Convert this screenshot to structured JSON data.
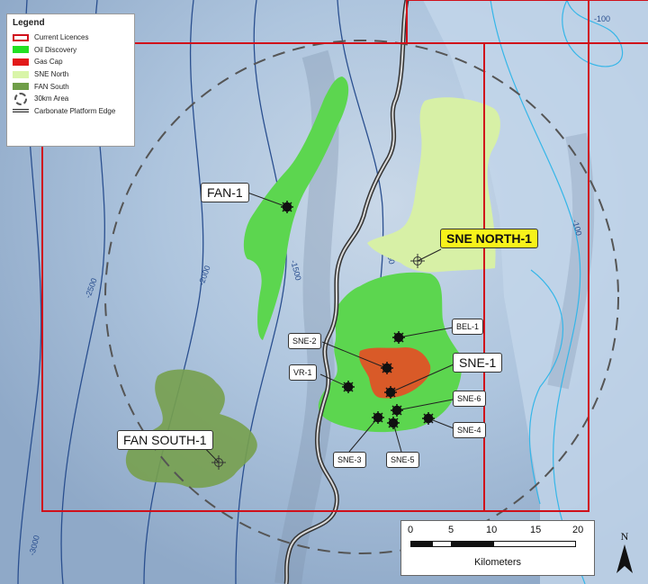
{
  "legend": {
    "title": "Legend",
    "items": [
      {
        "label": "Current Licences",
        "swatch": "licence-outline",
        "color": "#d0101a"
      },
      {
        "label": "Oil Discovery",
        "swatch": "fill",
        "color": "#22e022"
      },
      {
        "label": "Gas Cap",
        "swatch": "fill",
        "color": "#e21a1a"
      },
      {
        "label": "SNE North",
        "swatch": "fill",
        "color": "#d9f5a9"
      },
      {
        "label": "FAN South",
        "swatch": "fill",
        "color": "#6f9e48"
      },
      {
        "label": "30km Area",
        "swatch": "dashed-circle",
        "color": "#555555"
      },
      {
        "label": "Carbonate Platform Edge",
        "swatch": "double-line",
        "color": "#333333"
      }
    ]
  },
  "contours": [
    "-100",
    "-100",
    "-1000",
    "-1500",
    "-2000",
    "-2500",
    "-3000"
  ],
  "wells": [
    {
      "label": "FAN-1",
      "size": "big",
      "highlight": false
    },
    {
      "label": "SNE NORTH-1",
      "size": "big",
      "highlight": true
    },
    {
      "label": "SNE-1",
      "size": "big",
      "highlight": false
    },
    {
      "label": "FAN SOUTH-1",
      "size": "big",
      "highlight": false
    },
    {
      "label": "BEL-1",
      "size": "small",
      "highlight": false
    },
    {
      "label": "SNE-2",
      "size": "small",
      "highlight": false
    },
    {
      "label": "VR-1",
      "size": "small",
      "highlight": false
    },
    {
      "label": "SNE-6",
      "size": "small",
      "highlight": false
    },
    {
      "label": "SNE-4",
      "size": "small",
      "highlight": false
    },
    {
      "label": "SNE-3",
      "size": "small",
      "highlight": false
    },
    {
      "label": "SNE-5",
      "size": "small",
      "highlight": false
    }
  ],
  "scale": {
    "ticks": [
      "0",
      "5",
      "10",
      "15",
      "20"
    ],
    "unit": "Kilometers"
  },
  "north": "N",
  "colors": {
    "sea": "#a9c3de",
    "shelf": "#b8d0e6",
    "licence": "#d0101a",
    "oil": "#5cd64f",
    "gas": "#d95a28",
    "sne_north": "#d7f0a6",
    "fan_south": "#77a04e",
    "deep_contour": "#2a4f8f",
    "shallow_contour": "#35b6e8"
  }
}
